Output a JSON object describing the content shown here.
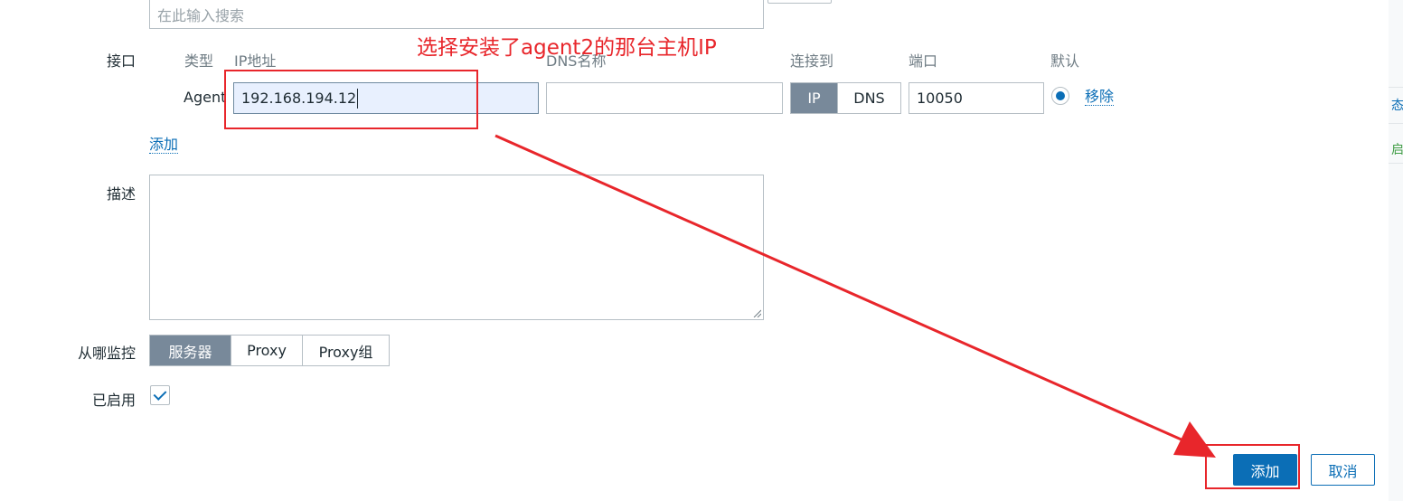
{
  "search": {
    "placeholder": "在此输入搜索"
  },
  "interfaces": {
    "label": "接口",
    "columns": {
      "type": "类型",
      "ip": "IP地址",
      "dns": "DNS名称",
      "connect_to": "连接到",
      "port": "端口",
      "default": "默认"
    },
    "row": {
      "type": "Agent",
      "ip": "192.168.194.12",
      "dns": "",
      "connect_options": [
        "IP",
        "DNS"
      ],
      "connect_selected": "IP",
      "port": "10050",
      "default_selected": true,
      "remove_label": "移除"
    },
    "add_label": "添加"
  },
  "description": {
    "label": "描述",
    "value": ""
  },
  "monitored_by": {
    "label": "从哪监控",
    "options": [
      "服务器",
      "Proxy",
      "Proxy组"
    ],
    "selected": "服务器"
  },
  "enabled": {
    "label": "已启用",
    "checked": true
  },
  "footer": {
    "add_button": "添加",
    "cancel_button": "取消"
  },
  "right_strip": {
    "item_1": "态",
    "item_2": "启"
  },
  "annotation": {
    "text": "选择安装了agent2的那台主机IP",
    "color": "#e8262b"
  },
  "colors": {
    "primary": "#0b6eb6",
    "active_segment": "#78899a",
    "annotation": "#e8262b"
  }
}
